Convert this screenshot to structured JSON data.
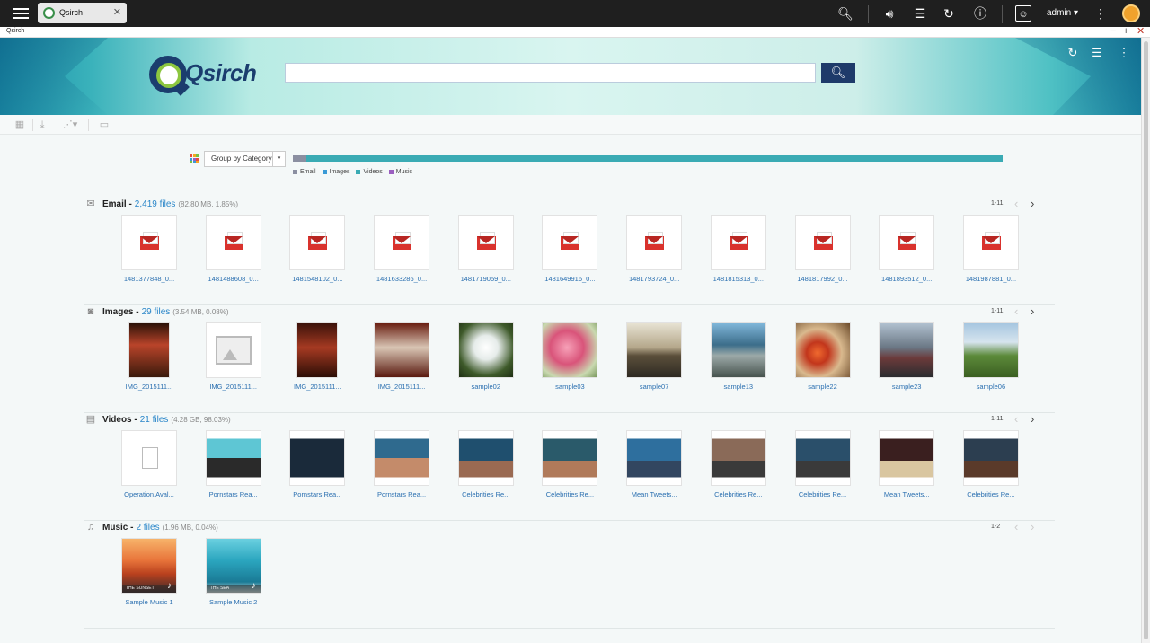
{
  "os_bar": {
    "tab_label": "Qsirch",
    "user": "admin"
  },
  "window": {
    "title": "Qsirch"
  },
  "header": {
    "logo_text": "Qsirch",
    "search_value": ""
  },
  "group": {
    "selected": "Group by Category"
  },
  "ratio": [
    {
      "name": "Email",
      "fraction": 0.0185,
      "color": "#8b8fa1"
    },
    {
      "name": "Images",
      "fraction": 0.0008,
      "color": "#3a9ad6"
    },
    {
      "name": "Videos",
      "fraction": 0.9803,
      "color": "#3aabb4"
    },
    {
      "name": "Music",
      "fraction": 0.0004,
      "color": "#9b5fc0"
    }
  ],
  "legend": [
    "Email",
    "Images",
    "Videos",
    "Music"
  ],
  "sections": {
    "email": {
      "title": "Email -",
      "count": "2,419 files",
      "meta": "(82.80 MB, 1.85%)",
      "range": "1-11",
      "items": [
        "1481377848_0...",
        "1481488608_0...",
        "1481548102_0...",
        "1481633286_0...",
        "1481719059_0...",
        "1481649916_0...",
        "1481793724_0...",
        "1481815313_0...",
        "1481817992_0...",
        "1481893512_0...",
        "1481987881_0..."
      ]
    },
    "images": {
      "title": "Images -",
      "count": "29 files",
      "meta": "(3.54 MB, 0.08%)",
      "range": "1-11",
      "items": [
        "IMG_2015111...",
        "IMG_2015111...",
        "IMG_2015111...",
        "IMG_2015111...",
        "sample02",
        "sample03",
        "sample07",
        "sample13",
        "sample22",
        "sample23",
        "sample06"
      ]
    },
    "videos": {
      "title": "Videos -",
      "count": "21 files",
      "meta": "(4.28 GB, 98.03%)",
      "range": "1-11",
      "items": [
        "Operation.Aval...",
        "Pornstars Rea...",
        "Pornstars Rea...",
        "Pornstars Rea...",
        "Celebrities Re...",
        "Celebrities Re...",
        "Mean Tweets...",
        "Celebrities Re...",
        "Celebrities Re...",
        "Mean Tweets...",
        "Celebrities Re..."
      ]
    },
    "music": {
      "title": "Music -",
      "count": "2 files",
      "meta": "(1.96 MB, 0.04%)",
      "range": "1-2",
      "items": [
        "Sample Music 1",
        "Sample Music 2"
      ],
      "band_labels": [
        "THE SUNSET",
        "THE SEA"
      ]
    }
  }
}
